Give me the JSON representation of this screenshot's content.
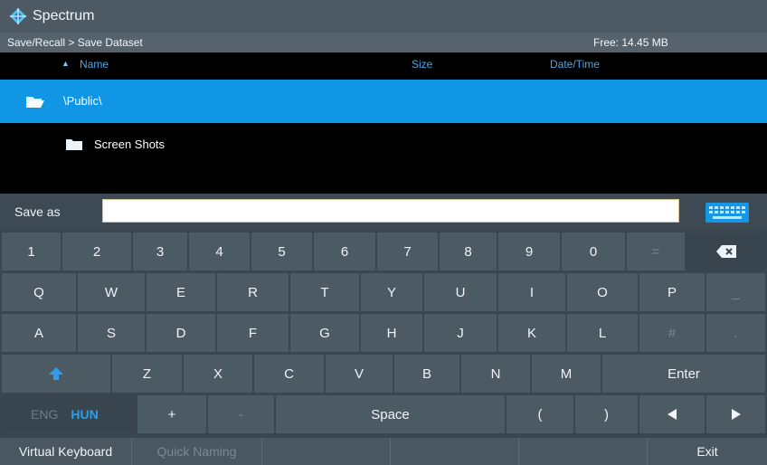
{
  "app": {
    "title": "Spectrum"
  },
  "path": {
    "breadcrumb": "Save/Recall > Save Dataset",
    "free": "Free: 14.45 MB"
  },
  "columns": {
    "name": "Name",
    "size": "Size",
    "date": "Date/Time"
  },
  "files": [
    {
      "name": "\\Public\\",
      "type": "folder-open",
      "selected": true
    },
    {
      "name": "Screen Shots",
      "type": "folder",
      "selected": false
    }
  ],
  "save": {
    "label": "Save as",
    "value": ""
  },
  "keyboard": {
    "row1": [
      "1",
      "2",
      "3",
      "4",
      "5",
      "6",
      "7",
      "8",
      "9",
      "0",
      "="
    ],
    "row2": [
      "Q",
      "W",
      "E",
      "R",
      "T",
      "Y",
      "U",
      "I",
      "O",
      "P",
      "_"
    ],
    "row3": [
      "A",
      "S",
      "D",
      "F",
      "G",
      "H",
      "J",
      "K",
      "L",
      "#",
      "."
    ],
    "row4": [
      "Z",
      "X",
      "C",
      "V",
      "B",
      "N",
      "M"
    ],
    "enter": "Enter",
    "eng": "ENG",
    "hun": "HUN",
    "plus": "+",
    "minus": "-",
    "space": "Space",
    "lparen": "(",
    "rparen": ")"
  },
  "softkeys": [
    "Virtual Keyboard",
    "Quick Naming",
    "",
    "",
    "",
    "Exit"
  ],
  "colors": {
    "accent": "#1196e6",
    "header_text": "#4aa7e6",
    "key": "#4c5a64"
  }
}
